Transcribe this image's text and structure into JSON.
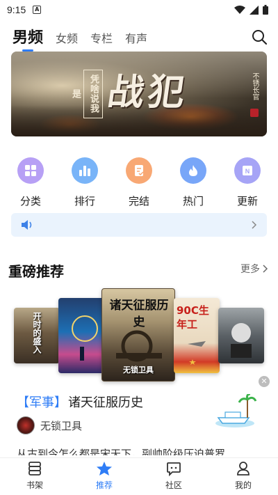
{
  "status_bar": {
    "time": "9:15",
    "notification_letter": "A"
  },
  "top_tabs": [
    {
      "label": "男频",
      "active": true
    },
    {
      "label": "女频",
      "active": false
    },
    {
      "label": "专栏",
      "active": false
    },
    {
      "label": "有声",
      "active": false
    }
  ],
  "banner": {
    "subtitle": "凭啥说我是",
    "title": "战犯",
    "author": "不锈长官"
  },
  "categories": [
    {
      "label": "分类",
      "icon": "grid-icon",
      "color": "#a98bf0"
    },
    {
      "label": "排行",
      "icon": "bar-chart-icon",
      "color": "#5ea3f7"
    },
    {
      "label": "完结",
      "icon": "document-check-icon",
      "color": "#f7935a"
    },
    {
      "label": "热门",
      "icon": "flame-icon",
      "color": "#5a8ff6"
    },
    {
      "label": "更新",
      "icon": "new-badge-icon",
      "color": "#8e8cf3"
    }
  ],
  "notice": {
    "icon": "speaker-icon",
    "text": ""
  },
  "section": {
    "title": "重磅推荐",
    "more_label": "更多"
  },
  "covers": [
    {
      "title": "开时的盛入"
    },
    {
      "title": ""
    },
    {
      "title": "诸天征服历史",
      "author": "无锁卫具"
    },
    {
      "title": "90C生年工"
    },
    {
      "title": ""
    }
  ],
  "featured_book": {
    "tag": "【军事】",
    "title": "诸天征服历史",
    "author": "无锁卫具",
    "description": "从古到今怎么都是宋天下，副帅阶级压迫普罗"
  },
  "bottom_nav": [
    {
      "label": "书架",
      "icon": "bookshelf-icon",
      "active": false
    },
    {
      "label": "推荐",
      "icon": "star-icon",
      "active": true
    },
    {
      "label": "社区",
      "icon": "chat-bubble-icon",
      "active": false
    },
    {
      "label": "我的",
      "icon": "profile-icon",
      "active": false
    }
  ],
  "colors": {
    "accent": "#2f7df6",
    "notice_bg": "#eaf3fd"
  }
}
